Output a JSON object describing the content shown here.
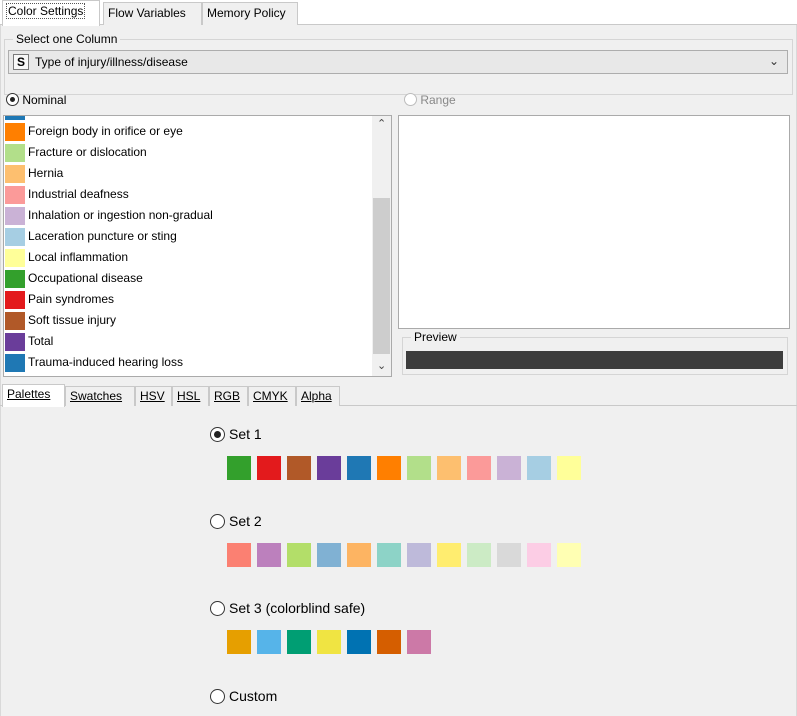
{
  "tabs": [
    "Color Settings",
    "Flow Variables",
    "Memory Policy"
  ],
  "column_group": {
    "title": "Select one Column",
    "type_badge": "S",
    "selected": "Type of injury/illness/disease"
  },
  "nominal": {
    "label": "Nominal",
    "selected": true
  },
  "range": {
    "label": "Range",
    "selected": false
  },
  "list_items": [
    {
      "label": "",
      "color": "#1f78b4"
    },
    {
      "label": "Foreign body in orifice or eye",
      "color": "#ff7f00"
    },
    {
      "label": "Fracture or dislocation",
      "color": "#b2df8a"
    },
    {
      "label": "Hernia",
      "color": "#fdbf6f"
    },
    {
      "label": "Industrial deafness",
      "color": "#fb9a99"
    },
    {
      "label": "Inhalation or ingestion non-gradual",
      "color": "#cab2d6"
    },
    {
      "label": "Laceration puncture or sting",
      "color": "#a6cee3"
    },
    {
      "label": "Local inflammation",
      "color": "#ffff99"
    },
    {
      "label": "Occupational disease",
      "color": "#33a02c"
    },
    {
      "label": "Pain syndromes",
      "color": "#e31a1c"
    },
    {
      "label": "Soft tissue injury",
      "color": "#b15928"
    },
    {
      "label": "Total",
      "color": "#6a3d9a"
    },
    {
      "label": "Trauma-induced hearing loss",
      "color": "#1f78b4"
    }
  ],
  "preview": {
    "title": "Preview",
    "color": "#3d3d3d"
  },
  "bottom_tabs": [
    "Palettes",
    "Swatches",
    "HSV",
    "HSL",
    "RGB",
    "CMYK",
    "Alpha"
  ],
  "palettes": [
    {
      "label": "Set 1",
      "selected": true,
      "colors": [
        "#33a02c",
        "#e31a1c",
        "#b15928",
        "#6a3d9a",
        "#1f78b4",
        "#ff7f00",
        "#b2df8a",
        "#fdbf6f",
        "#fb9a99",
        "#cab2d6",
        "#a6cee3",
        "#ffff99"
      ]
    },
    {
      "label": "Set 2",
      "selected": false,
      "colors": [
        "#fb8072",
        "#bc80bd",
        "#b3de69",
        "#80b1d3",
        "#fdb462",
        "#8dd3c7",
        "#bebada",
        "#ffed6f",
        "#ccebc5",
        "#d9d9d9",
        "#fccde5",
        "#ffffb3"
      ]
    },
    {
      "label": "Set 3 (colorblind safe)",
      "selected": false,
      "colors": [
        "#e69f00",
        "#56b4e9",
        "#009e73",
        "#f0e442",
        "#0072b2",
        "#d55e00",
        "#cc79a7"
      ]
    },
    {
      "label": "Custom",
      "selected": false,
      "colors": []
    }
  ]
}
